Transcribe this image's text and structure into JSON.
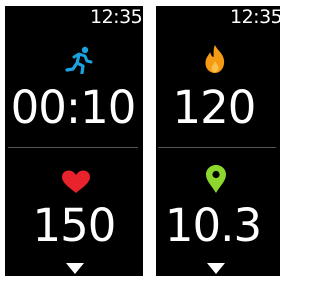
{
  "watch": {
    "left_panel": {
      "time": "12:35",
      "top_metric": {
        "icon": "running-person-icon",
        "icon_color": "#1aa3e0",
        "value": "00:10"
      },
      "bottom_metric": {
        "icon": "heart-icon",
        "icon_color": "#e8232b",
        "value": "150"
      }
    },
    "right_panel": {
      "time": "12:35",
      "top_metric": {
        "icon": "flame-icon",
        "icon_color": "#f59a13",
        "value": "120"
      },
      "bottom_metric": {
        "icon": "location-pin-icon",
        "icon_color": "#8dd62d",
        "value": "10.3"
      }
    }
  }
}
